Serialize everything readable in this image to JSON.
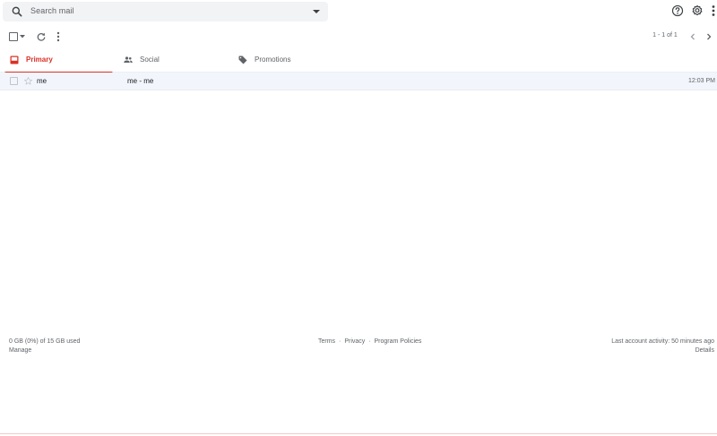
{
  "search": {
    "placeholder": "Search mail"
  },
  "pagination": {
    "range": "1 - 1 of 1"
  },
  "tabs": [
    {
      "label": "Primary",
      "icon": "inbox-icon",
      "active": true
    },
    {
      "label": "Social",
      "icon": "people-icon",
      "active": false
    },
    {
      "label": "Promotions",
      "icon": "tag-icon",
      "active": false
    }
  ],
  "messages": [
    {
      "sender": "me",
      "subject": "me - me",
      "time": "12:03 PM"
    }
  ],
  "footer": {
    "storage": "0 GB (0%) of 15 GB used",
    "manage": "Manage",
    "terms": "Terms",
    "privacy": "Privacy",
    "program_policies": "Program Policies",
    "separator": "·",
    "last_activity": "Last account activity: 50 minutes ago",
    "details": "Details"
  },
  "colors": {
    "accent": "#d93025",
    "search_bg": "#f1f3f4",
    "row_bg": "#f2f6fc",
    "muted_text": "#5f6368"
  }
}
